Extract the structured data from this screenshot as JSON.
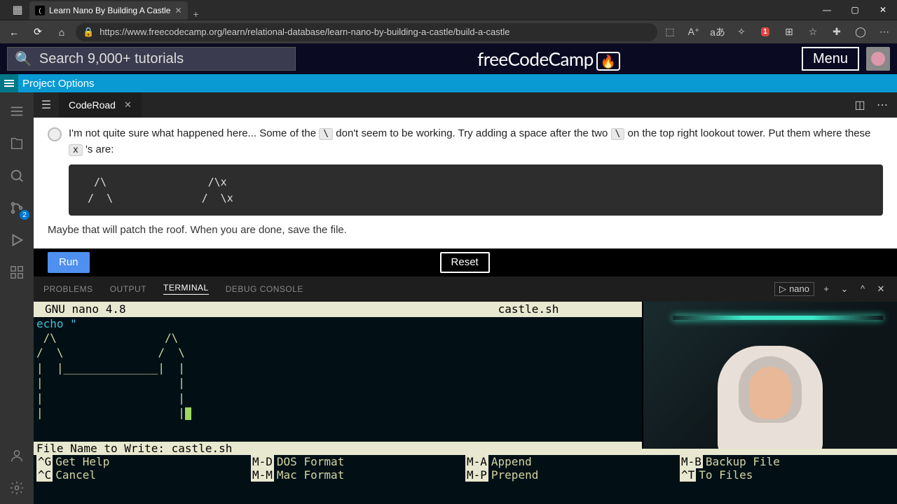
{
  "browser": {
    "tab_title": "Learn Nano By Building A Castle",
    "url": "https://www.freecodecamp.org/learn/relational-database/learn-nano-by-building-a-castle/build-a-castle",
    "adblock_badge": "1"
  },
  "fcc": {
    "search_placeholder": "Search 9,000+ tutorials",
    "logo_text": "freeCodeCamp",
    "menu_label": "Menu"
  },
  "project_bar": {
    "label": "Project Options"
  },
  "editor": {
    "tab": "CodeRoad",
    "right_icons": [
      "split",
      "more"
    ]
  },
  "coderoad": {
    "text1": "I'm not quite sure what happened here... Some of the ",
    "chip1": "\\",
    "text2": " don't seem to be working. Try adding a space after the two ",
    "chip2": "\\",
    "text3": " on the top right lookout tower. Put them where these ",
    "chip3": "x",
    "text4": " 's are:",
    "code_block": "  /\\                /\\x\n /  \\              /  \\x",
    "footer": "Maybe that will patch the roof. When you are done, save the file.",
    "run": "Run",
    "reset": "Reset"
  },
  "panel": {
    "tabs": [
      "PROBLEMS",
      "OUTPUT",
      "TERMINAL",
      "DEBUG CONSOLE"
    ],
    "active_tab": "TERMINAL",
    "term_label": "nano"
  },
  "nano": {
    "version": "GNU nano 4.8",
    "filename": "castle.sh",
    "echo": "echo \"",
    "art": " /\\                /\\\n/  \\              /  \\\n|  |______________|  |\n|                    |\n|                    |\n|                    |",
    "write_prompt": "File Name to Write: castle.sh",
    "shortcuts": [
      {
        "key": "^G",
        "label": "Get Help"
      },
      {
        "key": "M-D",
        "label": "DOS Format"
      },
      {
        "key": "M-A",
        "label": "Append"
      },
      {
        "key": "M-B",
        "label": "Backup File"
      },
      {
        "key": "^C",
        "label": "Cancel"
      },
      {
        "key": "M-M",
        "label": "Mac Format"
      },
      {
        "key": "M-P",
        "label": "Prepend"
      },
      {
        "key": "^T",
        "label": "To Files"
      }
    ]
  },
  "activity": {
    "scm_badge": "2"
  }
}
